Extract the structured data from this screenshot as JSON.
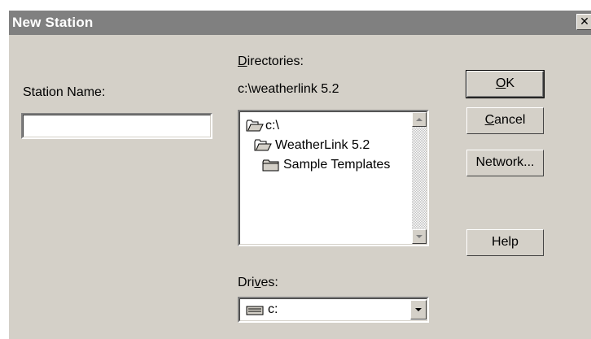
{
  "window": {
    "title": "New Station",
    "close_glyph": "✕"
  },
  "station": {
    "label": "Station Name:",
    "value": ""
  },
  "directories": {
    "label_prefix": "",
    "label_access": "D",
    "label_rest": "irectories:",
    "current_path": "c:\\weatherlink 5.2",
    "items": [
      {
        "label": "c:\\",
        "icon": "open-folder-icon"
      },
      {
        "label": "WeatherLink 5.2",
        "icon": "open-folder-icon"
      },
      {
        "label": "Sample Templates",
        "icon": "closed-folder-icon"
      }
    ]
  },
  "drives": {
    "label_prefix": "Dri",
    "label_access": "v",
    "label_rest": "es:",
    "selected": "c:",
    "icon": "hard-drive-icon"
  },
  "buttons": {
    "ok_access": "O",
    "ok_rest": "K",
    "cancel_access": "C",
    "cancel_rest": "ancel",
    "network": "Network...",
    "help": "Help"
  },
  "colors": {
    "face": "#d4d0c8",
    "titlebar_inactive": "#808080",
    "window_bg": "#ffffff"
  }
}
